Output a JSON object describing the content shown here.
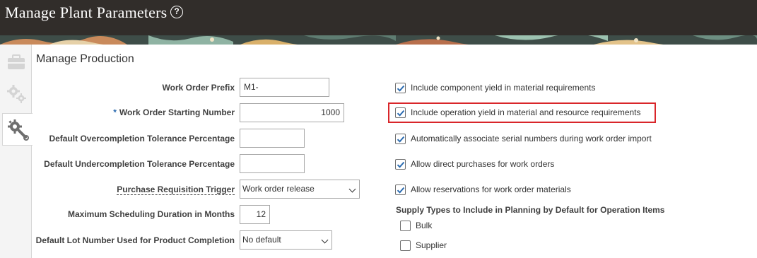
{
  "header": {
    "title": "Manage Plant Parameters",
    "help_icon": "question-circle-icon",
    "help_glyph": "?"
  },
  "colors": {
    "header_bg": "#312d2a",
    "highlight": "#d9262a",
    "check": "#2b6bb0"
  },
  "rail": {
    "tabs": [
      {
        "icon": "toolbox-icon",
        "active": false
      },
      {
        "icon": "gears-icon",
        "active": false
      },
      {
        "icon": "gear-wrench-icon",
        "active": true
      }
    ]
  },
  "section": {
    "title": "Manage Production"
  },
  "form": {
    "work_order_prefix": {
      "label": "Work Order Prefix",
      "value": "M1-"
    },
    "work_order_starting_number": {
      "label": "Work Order Starting Number",
      "value": "1000",
      "required_mark": "*"
    },
    "overcompletion": {
      "label": "Default Overcompletion Tolerance Percentage",
      "value": ""
    },
    "undercompletion": {
      "label": "Default Undercompletion Tolerance Percentage",
      "value": ""
    },
    "purchase_requisition_trigger": {
      "label": "Purchase Requisition Trigger",
      "value": "Work order release"
    },
    "max_scheduling_duration": {
      "label": "Maximum Scheduling Duration in Months",
      "value": "12"
    },
    "default_lot_number": {
      "label": "Default Lot Number Used for Product Completion",
      "value": "No default"
    }
  },
  "options": [
    {
      "label": "Include component yield in material requirements",
      "checked": true
    },
    {
      "label": "Include operation yield in material and resource requirements",
      "checked": true
    },
    {
      "label": "Automatically associate serial numbers during work order import",
      "checked": true
    },
    {
      "label": "Allow direct purchases for work orders",
      "checked": true
    },
    {
      "label": "Allow reservations for work order materials",
      "checked": true
    }
  ],
  "supply_types": {
    "title": "Supply Types to Include in Planning by Default for Operation Items",
    "items": [
      {
        "label": "Bulk",
        "checked": false
      },
      {
        "label": "Supplier",
        "checked": false
      }
    ]
  }
}
